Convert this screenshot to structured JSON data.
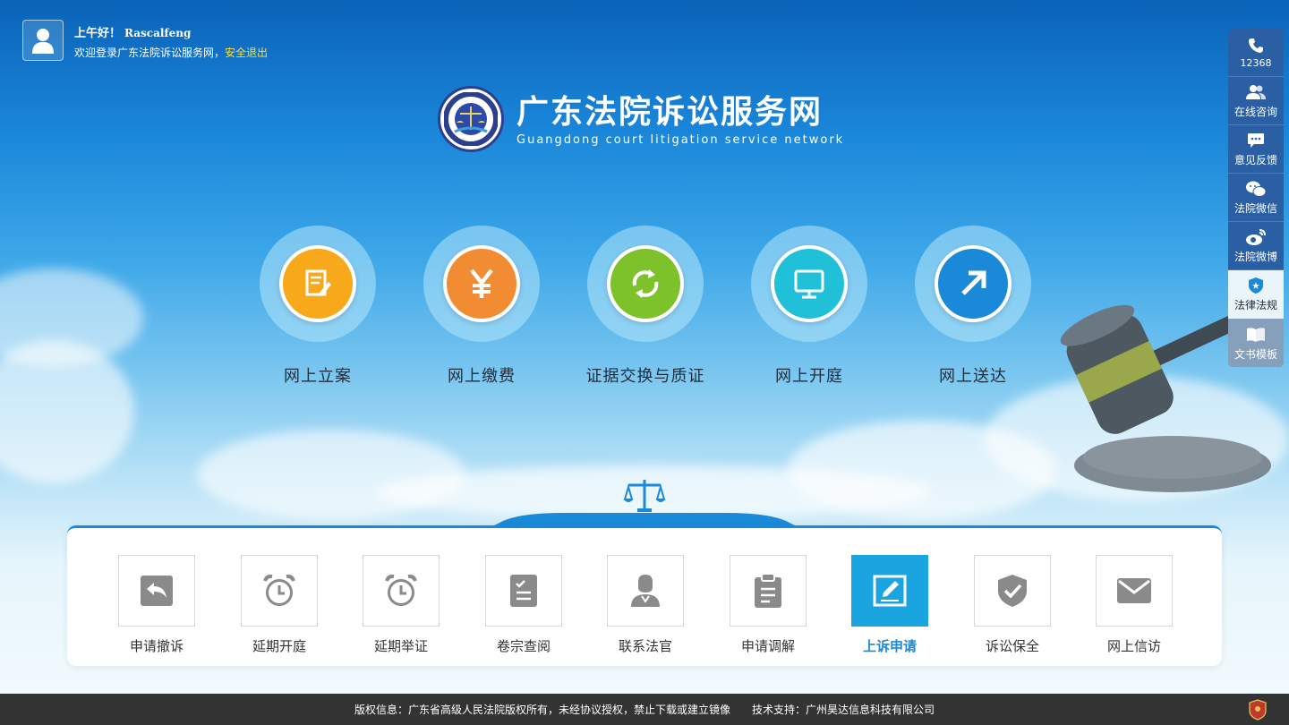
{
  "user": {
    "greeting": "上午好！",
    "username": "Rascalfeng",
    "welcome": "欢迎登录广东法院诉讼服务网，",
    "logout": "安全退出"
  },
  "logo": {
    "title_cn": "广东法院诉讼服务网",
    "title_en": "Guangdong court litigation service network"
  },
  "services": [
    {
      "label": "网上立案",
      "icon": "document-edit-icon",
      "color": "#f7a81b"
    },
    {
      "label": "网上缴费",
      "icon": "yuan-icon",
      "color": "#f28c33"
    },
    {
      "label": "证据交换与质证",
      "icon": "exchange-icon",
      "color": "#7dc12b"
    },
    {
      "label": "网上开庭",
      "icon": "monitor-icon",
      "color": "#1fc0d8"
    },
    {
      "label": "网上送达",
      "icon": "arrow-up-right-icon",
      "color": "#1a8ad8"
    }
  ],
  "sidebar": {
    "items": [
      {
        "label": "12368",
        "icon": "phone-icon"
      },
      {
        "label": "在线咨询",
        "icon": "users-icon"
      },
      {
        "label": "意见反馈",
        "icon": "chat-icon"
      },
      {
        "label": "法院微信",
        "icon": "wechat-icon"
      },
      {
        "label": "法院微博",
        "icon": "weibo-icon"
      },
      {
        "label": "法律法规",
        "icon": "shield-star-icon"
      },
      {
        "label": "文书模板",
        "icon": "book-icon"
      }
    ]
  },
  "tools": [
    {
      "label": "申请撤诉",
      "icon": "reply-icon"
    },
    {
      "label": "延期开庭",
      "icon": "alarm-clock-icon"
    },
    {
      "label": "延期举证",
      "icon": "alarm-clock-icon"
    },
    {
      "label": "卷宗查阅",
      "icon": "checklist-icon"
    },
    {
      "label": "联系法官",
      "icon": "judge-icon"
    },
    {
      "label": "申请调解",
      "icon": "clipboard-icon"
    },
    {
      "label": "上诉申请",
      "icon": "pen-edit-icon",
      "active": true
    },
    {
      "label": "诉讼保全",
      "icon": "shield-check-icon"
    },
    {
      "label": "网上信访",
      "icon": "mail-icon"
    }
  ],
  "footer": {
    "copyright": "版权信息：广东省高级人民法院版权所有，未经协议授权，禁止下载或建立镜像",
    "support": "技术支持：广州昊达信息科技有限公司"
  },
  "colors": {
    "accent": "#1a8ad8",
    "active_tool": "#1aa5e0",
    "footer_bg": "#333333",
    "logout": "#ffde3a"
  }
}
